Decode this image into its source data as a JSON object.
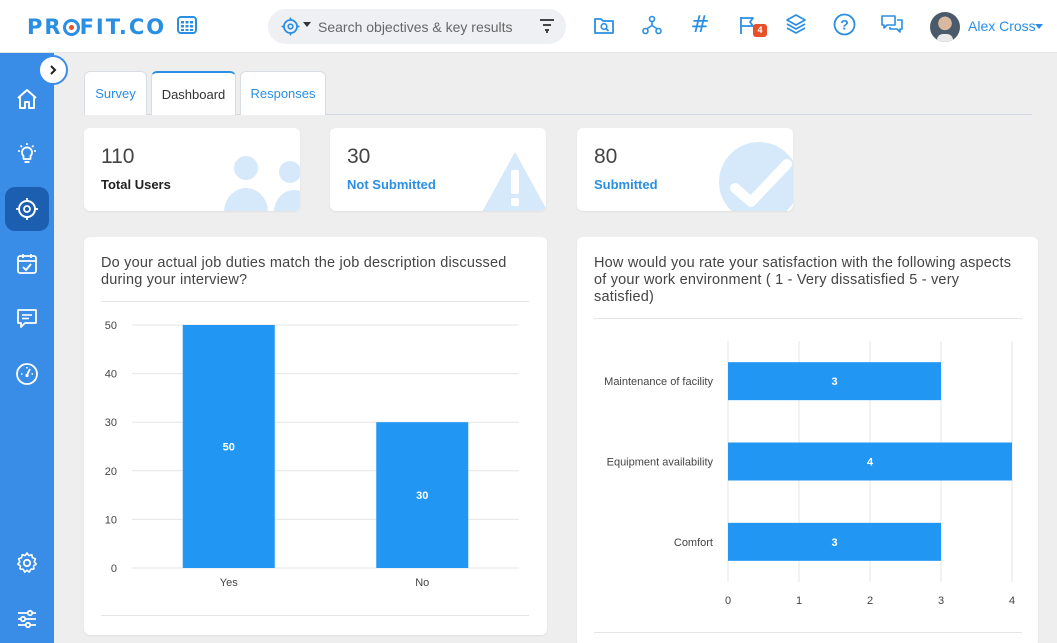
{
  "app": {
    "logo": "PROFIT.CO",
    "search_placeholder": "Search objectives & key results",
    "notification_count": "4",
    "user_name": "Alex Cross"
  },
  "tabs": [
    {
      "label": "Survey"
    },
    {
      "label": "Dashboard"
    },
    {
      "label": "Responses"
    }
  ],
  "stats": {
    "total": {
      "value": "110",
      "label": "Total Users"
    },
    "not_submitted": {
      "value": "30",
      "label": "Not Submitted"
    },
    "submitted": {
      "value": "80",
      "label": "Submitted"
    }
  },
  "colors": {
    "accent": "#2a8fe3",
    "bar": "#2196f3",
    "sidebar": "#3a8de6",
    "sidebar_active": "#1c5fb0",
    "icon_light": "#d6e9fb"
  },
  "chart_data": [
    {
      "type": "bar",
      "title": "Do your actual job duties match the job description discussed during your interview?",
      "categories": [
        "Yes",
        "No"
      ],
      "values": [
        50,
        30
      ],
      "ylim": [
        0,
        50
      ],
      "yticks": [
        0,
        10,
        20,
        30,
        40,
        50
      ],
      "grid": true,
      "data_labels": true
    },
    {
      "type": "bar",
      "orientation": "horizontal",
      "title": "How would you rate your satisfaction with the following aspects of your work environment ( 1 - Very dissatisfied 5 - very satisfied)",
      "categories": [
        "Maintenance of facility",
        "Equipment availability",
        "Comfort"
      ],
      "values": [
        3,
        4,
        3
      ],
      "xlim": [
        0,
        4
      ],
      "xticks": [
        0,
        1,
        2,
        3,
        4
      ],
      "grid": true,
      "data_labels": true
    }
  ]
}
